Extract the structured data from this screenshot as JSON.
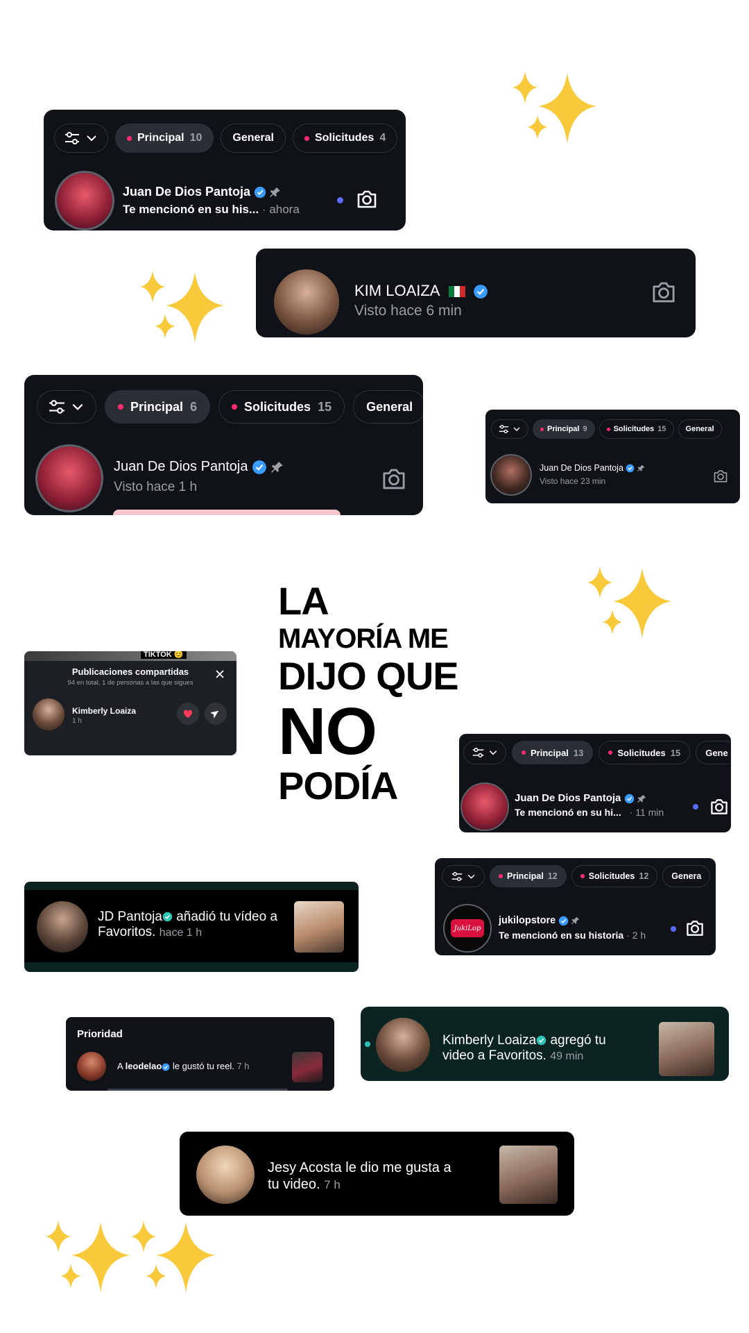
{
  "headline": {
    "line1": "LA",
    "line2": "MAYORÍA ME",
    "line3": "DIJO QUE",
    "line4": "NO",
    "line5": "PODÍA"
  },
  "card1": {
    "tabs": [
      {
        "label": "Principal",
        "count": "10",
        "active": true,
        "dot": true
      },
      {
        "label": "General",
        "count": "",
        "active": false,
        "dot": false
      },
      {
        "label": "Solicitudes",
        "count": "4",
        "active": false,
        "dot": true
      }
    ],
    "name": "Juan De Dios Pantoja",
    "message": "Te mencionó en su his...",
    "time": "· ahora"
  },
  "card2": {
    "name": "KIM LOAIZA",
    "status": "Visto hace 6 min"
  },
  "card3": {
    "tabs": [
      {
        "label": "Principal",
        "count": "6",
        "active": true,
        "dot": true
      },
      {
        "label": "Solicitudes",
        "count": "15",
        "active": false,
        "dot": true
      },
      {
        "label": "General",
        "count": "",
        "active": false,
        "dot": false
      }
    ],
    "name": "Juan De Dios Pantoja",
    "status": "Visto hace 1 h"
  },
  "card4": {
    "tabs": [
      {
        "label": "Principal",
        "count": "9",
        "active": true,
        "dot": true
      },
      {
        "label": "Solicitudes",
        "count": "15",
        "active": false,
        "dot": true
      },
      {
        "label": "General",
        "count": "",
        "active": false,
        "dot": false
      }
    ],
    "name": "Juan De Dios Pantoja",
    "status": "Visto hace 23 min"
  },
  "card5": {
    "banner": "TIKTOK 😊",
    "title": "Publicaciones compartidas",
    "subtitle": "94 en total, 1 de personas a las que sigues",
    "name": "Kimberly Loaiza",
    "time": "1 h"
  },
  "card6": {
    "tabs": [
      {
        "label": "Principal",
        "count": "13",
        "active": true,
        "dot": true
      },
      {
        "label": "Solicitudes",
        "count": "15",
        "active": false,
        "dot": true
      },
      {
        "label": "Gene",
        "count": "",
        "active": false,
        "dot": false
      }
    ],
    "name": "Juan De Dios Pantoja",
    "message": "Te mencionó en su hi...",
    "time": "· 11 min"
  },
  "card7": {
    "name": "JD Pantoja",
    "action1": " añadió tu vídeo a",
    "action2": "Favoritos.",
    "time": "hace 1 h"
  },
  "card8": {
    "tabs": [
      {
        "label": "Principal",
        "count": "12",
        "active": true,
        "dot": true
      },
      {
        "label": "Solicitudes",
        "count": "12",
        "active": false,
        "dot": true
      },
      {
        "label": "Genera",
        "count": "",
        "active": false,
        "dot": false
      }
    ],
    "name": "jukilopstore",
    "message": "Te mencionó en su historia",
    "time": "· 2 h",
    "logo_text": "JukiLop"
  },
  "card9": {
    "title": "Prioridad",
    "prefix": "A ",
    "user": "leodelao",
    "action": " le gustó tu reel.",
    "time": "7 h"
  },
  "card10": {
    "name": "Kimberly Loaiza",
    "action1": " agregó tu",
    "action2": "video a Favoritos.",
    "time": "49 min"
  },
  "card11": {
    "line1": "Jesy Acosta le dio me gusta a",
    "line2": "tu video.",
    "time": "7 h"
  },
  "colors": {
    "card_bg": "#0f1216",
    "pill_dot": "#ff2d6f",
    "verified": "#3b9cff",
    "verified_teal": "#2ec4b6",
    "unread": "#5b6cff",
    "teal_card": "#0b2321",
    "sparkle": "#f7c93b"
  }
}
